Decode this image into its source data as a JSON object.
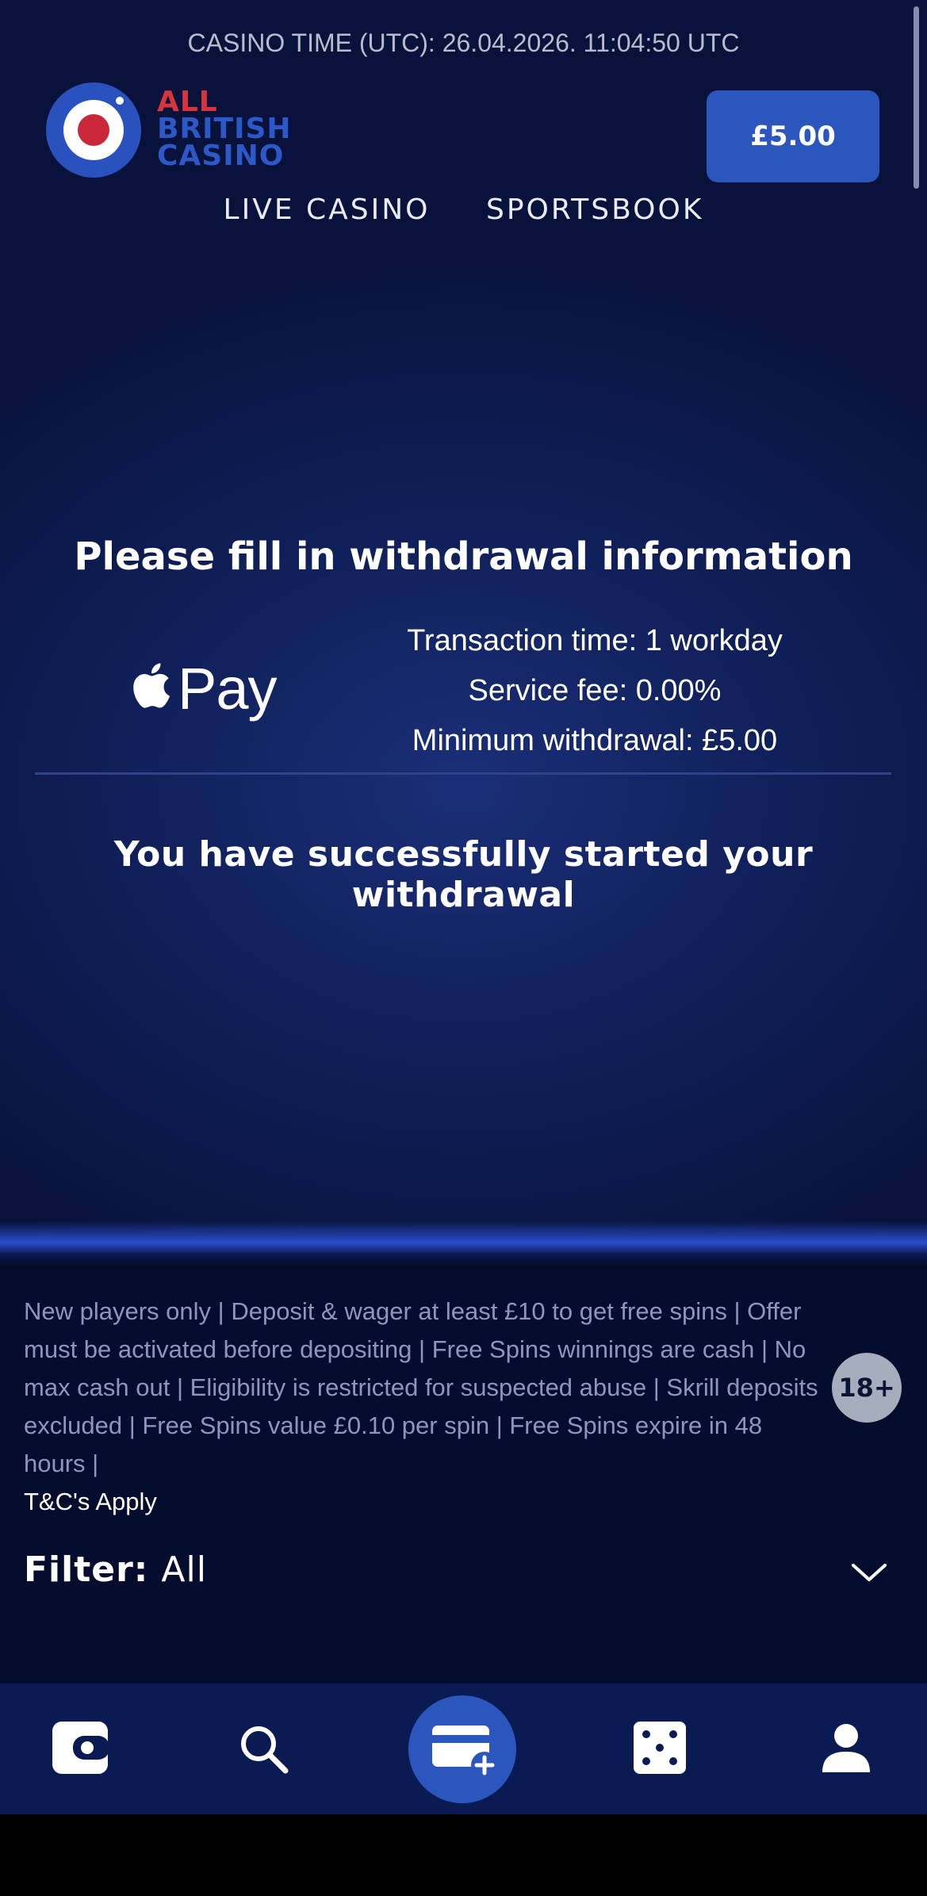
{
  "header": {
    "casino_time": "CASINO TIME (UTC): 26.04.2026. 11:04:50 UTC",
    "logo_line1": "ALL",
    "logo_line2": "BRITISH",
    "logo_line3": "CASINO",
    "balance": "£5.00"
  },
  "nav": {
    "items": [
      {
        "label": "LIVE CASINO"
      },
      {
        "label": "SPORTSBOOK"
      }
    ]
  },
  "withdrawal": {
    "heading": "Please fill in withdrawal information",
    "method_label": "Pay",
    "transaction_time": "Transaction time: 1 workday",
    "service_fee": "Service fee: 0.00%",
    "minimum_withdrawal": "Minimum withdrawal: £5.00",
    "success_message": "You have successfully started your withdrawal"
  },
  "terms": {
    "text": "New players only | Deposit & wager at least £10 to get free spins | Offer must be activated before depositing | Free Spins winnings are cash | No max cash out | Eligibility is restricted for suspected abuse | Skrill deposits excluded | Free Spins value £0.10 per spin | Free Spins expire in 48 hours |",
    "link": "T&C's Apply",
    "age_badge": "18+"
  },
  "filter": {
    "label": "Filter:",
    "value": "All"
  },
  "tabbar": {
    "icons": [
      "wallet-icon",
      "search-icon",
      "deposit-card-icon",
      "dice-icon",
      "user-icon"
    ]
  },
  "colors": {
    "brand_blue": "#2b56bd",
    "brand_red": "#d8343c",
    "background_dark": "#050d2f"
  }
}
